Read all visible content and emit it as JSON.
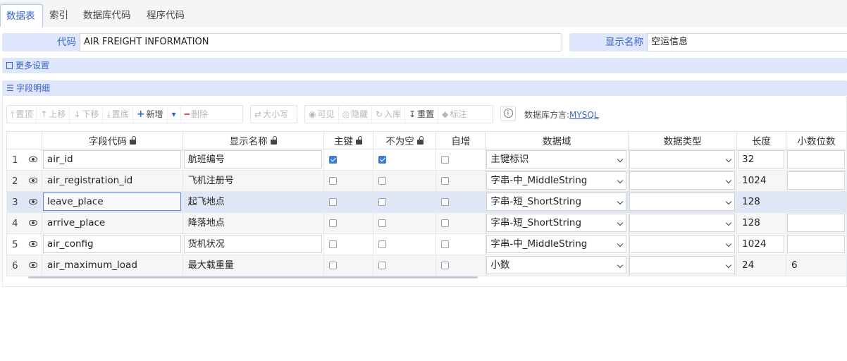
{
  "tabs": [
    {
      "label": "数据表",
      "active": true
    },
    {
      "label": "索引",
      "active": false
    },
    {
      "label": "数据库代码",
      "active": false
    },
    {
      "label": "程序代码",
      "active": false
    }
  ],
  "form": {
    "code_label": "代码",
    "code_value": "AIR FREIGHT INFORMATION",
    "display_label": "显示名称",
    "display_value": "空运信息"
  },
  "sections": {
    "more_settings": "更多设置",
    "field_detail": "字段明细"
  },
  "toolbar": {
    "top": "置顶",
    "up": "上移",
    "down": "下移",
    "bottom": "置底",
    "add": "新增",
    "delete": "删除",
    "case": "大小写",
    "visible": "可见",
    "hide": "隐藏",
    "import": "入库",
    "reset": "重置",
    "mark": "标注",
    "dialect_label": "数据库方言:",
    "dialect_value": "MYSQL"
  },
  "columns": [
    "字段代码",
    "显示名称",
    "主键",
    "不为空",
    "自增",
    "数据域",
    "数据类型",
    "长度",
    "小数位数"
  ],
  "rows": [
    {
      "num": "1",
      "code": "air_id",
      "name": "航班编号",
      "pk": true,
      "notnull": true,
      "auto": false,
      "domain": "主键标识",
      "type": "",
      "length": "32",
      "scale": ""
    },
    {
      "num": "2",
      "code": "air_registration_id",
      "name": "飞机注册号",
      "pk": false,
      "notnull": false,
      "auto": false,
      "domain": "字串-中_MiddleString",
      "type": "",
      "length": "1024",
      "scale": ""
    },
    {
      "num": "3",
      "code": "leave_place",
      "name": "起飞地点",
      "pk": false,
      "notnull": false,
      "auto": false,
      "domain": "字串-短_ShortString",
      "type": "",
      "length": "128",
      "scale": ""
    },
    {
      "num": "4",
      "code": "arrive_place",
      "name": "降落地点",
      "pk": false,
      "notnull": false,
      "auto": false,
      "domain": "字串-短_ShortString",
      "type": "",
      "length": "128",
      "scale": ""
    },
    {
      "num": "5",
      "code": "air_config",
      "name": "货机状况",
      "pk": false,
      "notnull": false,
      "auto": false,
      "domain": "字串-中_MiddleString",
      "type": "",
      "length": "1024",
      "scale": ""
    },
    {
      "num": "6",
      "code": "air_maximum_load",
      "name": "最大载重量",
      "pk": false,
      "notnull": false,
      "auto": false,
      "domain": "小数",
      "type": "",
      "length": "24",
      "scale": "6"
    }
  ]
}
